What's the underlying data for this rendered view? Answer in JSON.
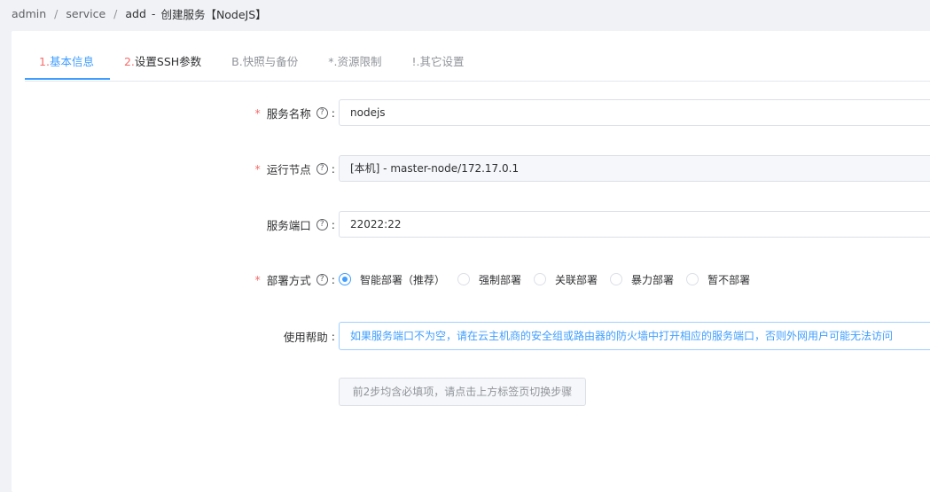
{
  "breadcrumb": {
    "items": [
      "admin",
      "service",
      "add"
    ],
    "current": "创建服务【NodeJS】",
    "dash": "-"
  },
  "tabs": [
    {
      "prefix": "1.",
      "label": "基本信息",
      "state": "active"
    },
    {
      "prefix": "2.",
      "label": "设置SSH参数",
      "state": "done"
    },
    {
      "prefix": "B.",
      "label": "快照与备份",
      "state": "plain"
    },
    {
      "prefix": "*.",
      "label": "资源限制",
      "state": "plain"
    },
    {
      "prefix": "!.",
      "label": "其它设置",
      "state": "plain"
    }
  ],
  "form": {
    "service_name": {
      "label": "服务名称",
      "required": true,
      "value": "nodejs"
    },
    "run_node": {
      "label": "运行节点",
      "required": true,
      "value": "[本机] - master-node/172.17.0.1"
    },
    "service_port": {
      "label": "服务端口",
      "required": false,
      "value": "22022:22"
    },
    "deploy_mode": {
      "label": "部署方式",
      "required": true,
      "options": [
        "智能部署（推荐）",
        "强制部署",
        "关联部署",
        "暴力部署",
        "暂不部署"
      ],
      "selected": 0
    },
    "help": {
      "label": "使用帮助",
      "value": "如果服务端口不为空，请在云主机商的安全组或路由器的防火墙中打开相应的服务端口，否则外网用户可能无法访问"
    },
    "hint_button": "前2步均含必填项，请点击上方标签页切换步骤"
  },
  "symbols": {
    "required": "*",
    "help": "?",
    "colon": ":"
  },
  "colors": {
    "accent": "#409eff",
    "required": "#f56c6c",
    "tab_number": "#f56c6c"
  }
}
